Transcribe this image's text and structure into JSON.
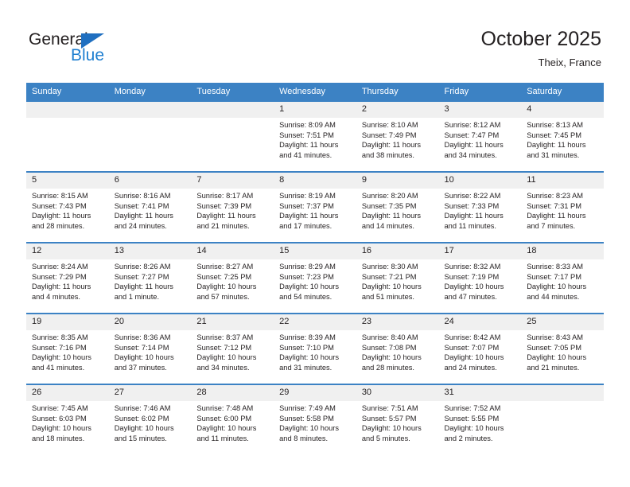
{
  "brand": {
    "name_top": "General",
    "name_bottom": "Blue",
    "accent_color": "#1f7fd0",
    "triangle_color": "#1f6fc0"
  },
  "header": {
    "title": "October 2025",
    "location": "Theix, France"
  },
  "calendar": {
    "header_bg": "#3c82c4",
    "daynum_bg": "#f0f0f0",
    "weekdays": [
      "Sunday",
      "Monday",
      "Tuesday",
      "Wednesday",
      "Thursday",
      "Friday",
      "Saturday"
    ],
    "labels": {
      "sunrise": "Sunrise:",
      "sunset": "Sunset:",
      "daylight": "Daylight:"
    },
    "weeks": [
      [
        {
          "day": "",
          "empty": true
        },
        {
          "day": "",
          "empty": true
        },
        {
          "day": "",
          "empty": true
        },
        {
          "day": "1",
          "sunrise": "Sunrise: 8:09 AM",
          "sunset": "Sunset: 7:51 PM",
          "daylight_1": "Daylight: 11 hours",
          "daylight_2": "and 41 minutes."
        },
        {
          "day": "2",
          "sunrise": "Sunrise: 8:10 AM",
          "sunset": "Sunset: 7:49 PM",
          "daylight_1": "Daylight: 11 hours",
          "daylight_2": "and 38 minutes."
        },
        {
          "day": "3",
          "sunrise": "Sunrise: 8:12 AM",
          "sunset": "Sunset: 7:47 PM",
          "daylight_1": "Daylight: 11 hours",
          "daylight_2": "and 34 minutes."
        },
        {
          "day": "4",
          "sunrise": "Sunrise: 8:13 AM",
          "sunset": "Sunset: 7:45 PM",
          "daylight_1": "Daylight: 11 hours",
          "daylight_2": "and 31 minutes."
        }
      ],
      [
        {
          "day": "5",
          "sunrise": "Sunrise: 8:15 AM",
          "sunset": "Sunset: 7:43 PM",
          "daylight_1": "Daylight: 11 hours",
          "daylight_2": "and 28 minutes."
        },
        {
          "day": "6",
          "sunrise": "Sunrise: 8:16 AM",
          "sunset": "Sunset: 7:41 PM",
          "daylight_1": "Daylight: 11 hours",
          "daylight_2": "and 24 minutes."
        },
        {
          "day": "7",
          "sunrise": "Sunrise: 8:17 AM",
          "sunset": "Sunset: 7:39 PM",
          "daylight_1": "Daylight: 11 hours",
          "daylight_2": "and 21 minutes."
        },
        {
          "day": "8",
          "sunrise": "Sunrise: 8:19 AM",
          "sunset": "Sunset: 7:37 PM",
          "daylight_1": "Daylight: 11 hours",
          "daylight_2": "and 17 minutes."
        },
        {
          "day": "9",
          "sunrise": "Sunrise: 8:20 AM",
          "sunset": "Sunset: 7:35 PM",
          "daylight_1": "Daylight: 11 hours",
          "daylight_2": "and 14 minutes."
        },
        {
          "day": "10",
          "sunrise": "Sunrise: 8:22 AM",
          "sunset": "Sunset: 7:33 PM",
          "daylight_1": "Daylight: 11 hours",
          "daylight_2": "and 11 minutes."
        },
        {
          "day": "11",
          "sunrise": "Sunrise: 8:23 AM",
          "sunset": "Sunset: 7:31 PM",
          "daylight_1": "Daylight: 11 hours",
          "daylight_2": "and 7 minutes."
        }
      ],
      [
        {
          "day": "12",
          "sunrise": "Sunrise: 8:24 AM",
          "sunset": "Sunset: 7:29 PM",
          "daylight_1": "Daylight: 11 hours",
          "daylight_2": "and 4 minutes."
        },
        {
          "day": "13",
          "sunrise": "Sunrise: 8:26 AM",
          "sunset": "Sunset: 7:27 PM",
          "daylight_1": "Daylight: 11 hours",
          "daylight_2": "and 1 minute."
        },
        {
          "day": "14",
          "sunrise": "Sunrise: 8:27 AM",
          "sunset": "Sunset: 7:25 PM",
          "daylight_1": "Daylight: 10 hours",
          "daylight_2": "and 57 minutes."
        },
        {
          "day": "15",
          "sunrise": "Sunrise: 8:29 AM",
          "sunset": "Sunset: 7:23 PM",
          "daylight_1": "Daylight: 10 hours",
          "daylight_2": "and 54 minutes."
        },
        {
          "day": "16",
          "sunrise": "Sunrise: 8:30 AM",
          "sunset": "Sunset: 7:21 PM",
          "daylight_1": "Daylight: 10 hours",
          "daylight_2": "and 51 minutes."
        },
        {
          "day": "17",
          "sunrise": "Sunrise: 8:32 AM",
          "sunset": "Sunset: 7:19 PM",
          "daylight_1": "Daylight: 10 hours",
          "daylight_2": "and 47 minutes."
        },
        {
          "day": "18",
          "sunrise": "Sunrise: 8:33 AM",
          "sunset": "Sunset: 7:17 PM",
          "daylight_1": "Daylight: 10 hours",
          "daylight_2": "and 44 minutes."
        }
      ],
      [
        {
          "day": "19",
          "sunrise": "Sunrise: 8:35 AM",
          "sunset": "Sunset: 7:16 PM",
          "daylight_1": "Daylight: 10 hours",
          "daylight_2": "and 41 minutes."
        },
        {
          "day": "20",
          "sunrise": "Sunrise: 8:36 AM",
          "sunset": "Sunset: 7:14 PM",
          "daylight_1": "Daylight: 10 hours",
          "daylight_2": "and 37 minutes."
        },
        {
          "day": "21",
          "sunrise": "Sunrise: 8:37 AM",
          "sunset": "Sunset: 7:12 PM",
          "daylight_1": "Daylight: 10 hours",
          "daylight_2": "and 34 minutes."
        },
        {
          "day": "22",
          "sunrise": "Sunrise: 8:39 AM",
          "sunset": "Sunset: 7:10 PM",
          "daylight_1": "Daylight: 10 hours",
          "daylight_2": "and 31 minutes."
        },
        {
          "day": "23",
          "sunrise": "Sunrise: 8:40 AM",
          "sunset": "Sunset: 7:08 PM",
          "daylight_1": "Daylight: 10 hours",
          "daylight_2": "and 28 minutes."
        },
        {
          "day": "24",
          "sunrise": "Sunrise: 8:42 AM",
          "sunset": "Sunset: 7:07 PM",
          "daylight_1": "Daylight: 10 hours",
          "daylight_2": "and 24 minutes."
        },
        {
          "day": "25",
          "sunrise": "Sunrise: 8:43 AM",
          "sunset": "Sunset: 7:05 PM",
          "daylight_1": "Daylight: 10 hours",
          "daylight_2": "and 21 minutes."
        }
      ],
      [
        {
          "day": "26",
          "sunrise": "Sunrise: 7:45 AM",
          "sunset": "Sunset: 6:03 PM",
          "daylight_1": "Daylight: 10 hours",
          "daylight_2": "and 18 minutes."
        },
        {
          "day": "27",
          "sunrise": "Sunrise: 7:46 AM",
          "sunset": "Sunset: 6:02 PM",
          "daylight_1": "Daylight: 10 hours",
          "daylight_2": "and 15 minutes."
        },
        {
          "day": "28",
          "sunrise": "Sunrise: 7:48 AM",
          "sunset": "Sunset: 6:00 PM",
          "daylight_1": "Daylight: 10 hours",
          "daylight_2": "and 11 minutes."
        },
        {
          "day": "29",
          "sunrise": "Sunrise: 7:49 AM",
          "sunset": "Sunset: 5:58 PM",
          "daylight_1": "Daylight: 10 hours",
          "daylight_2": "and 8 minutes."
        },
        {
          "day": "30",
          "sunrise": "Sunrise: 7:51 AM",
          "sunset": "Sunset: 5:57 PM",
          "daylight_1": "Daylight: 10 hours",
          "daylight_2": "and 5 minutes."
        },
        {
          "day": "31",
          "sunrise": "Sunrise: 7:52 AM",
          "sunset": "Sunset: 5:55 PM",
          "daylight_1": "Daylight: 10 hours",
          "daylight_2": "and 2 minutes."
        },
        {
          "day": "",
          "empty": true
        }
      ]
    ]
  }
}
